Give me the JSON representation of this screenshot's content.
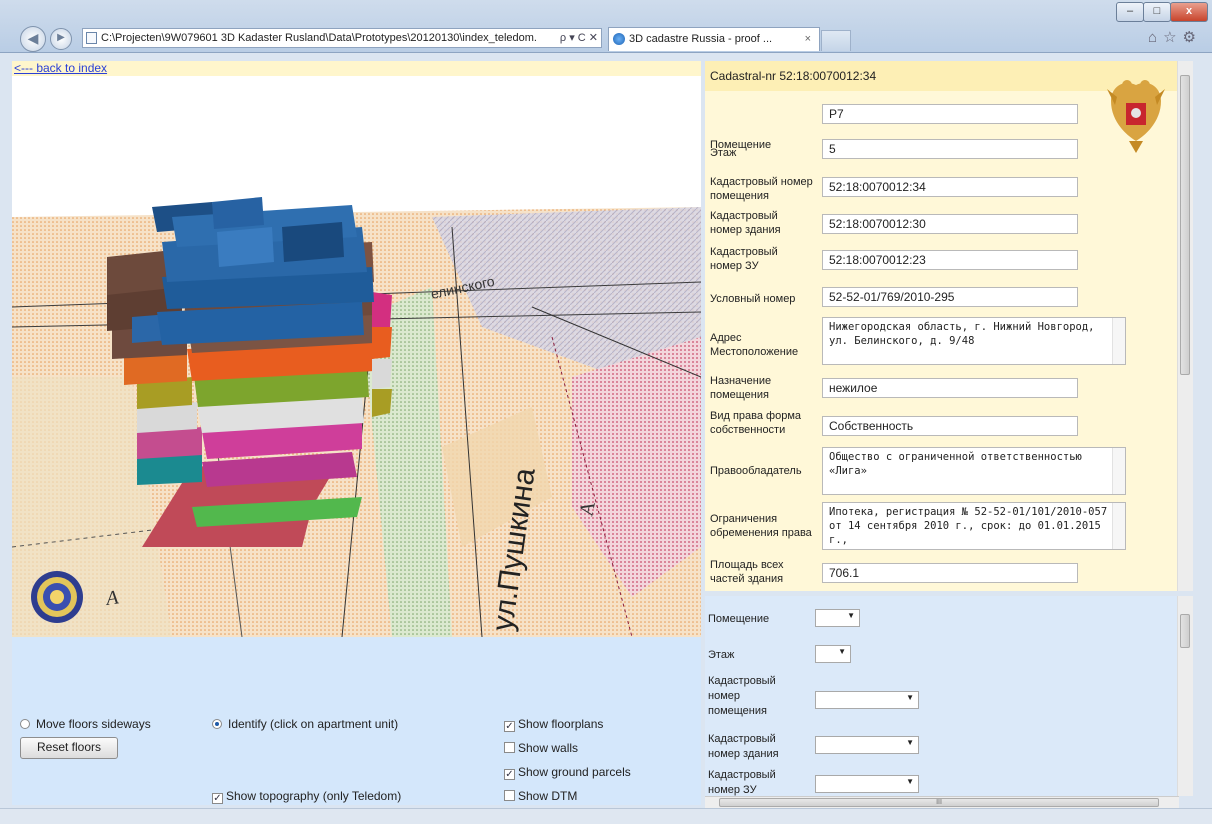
{
  "browser": {
    "address": "C:\\Projecten\\9W079601 3D Kadaster Rusland\\Data\\Prototypes\\20120130\\index_teledom.",
    "address_actions": "ρ ▾ C ✕",
    "tab_title": "3D cadastre Russia - proof ...",
    "tab_close": "×",
    "window_controls": [
      "–",
      "□",
      "x"
    ],
    "toolbar_icons": [
      "home-icon",
      "star-icon",
      "gear-icon"
    ]
  },
  "left": {
    "back_link": "<--- back to index",
    "map": {
      "street_label": "ул.Пушкина",
      "street_label2": "елинского",
      "letter_a": "A",
      "letter_a2": "A"
    },
    "controls": {
      "move_floors": "Move floors sideways",
      "identify": "Identify (click on apartment unit)",
      "reset_floors": "Reset floors",
      "show_floorplans": "Show floorplans",
      "show_walls": "Show walls",
      "show_ground_parcels": "Show ground parcels",
      "show_topography": "Show topography (only Teledom)",
      "show_dtm": "Show DTM",
      "state": {
        "move_floors": false,
        "identify": true,
        "floorplans": true,
        "walls": false,
        "ground_parcels": true,
        "topography": true,
        "dtm": false
      }
    }
  },
  "right": {
    "header": "Cadastral-nr 52:18:0070012:34",
    "fields": [
      {
        "label": "Помещение",
        "value": "P7"
      },
      {
        "label": "Этаж",
        "value": "5"
      },
      {
        "label": "Кадастровый номер помещения",
        "value": "52:18:0070012:34"
      },
      {
        "label": "Кадастровый номер здания",
        "value": "52:18:0070012:30"
      },
      {
        "label": "Кадастровый номер ЗУ",
        "value": "52:18:0070012:23"
      },
      {
        "label": "Условный номер",
        "value": "52-52-01/769/2010-295"
      },
      {
        "label": "Адрес Местоположение",
        "value": "Нижегородская область, г. Нижний Новгород, ул. Белинского, д. 9/48"
      },
      {
        "label": "Назначение помещения",
        "value": "нежилое"
      },
      {
        "label": "Вид права форма собственности",
        "value": "Собственность"
      },
      {
        "label": "Правообладатель",
        "value": "Общество с ограниченной ответственностью «Лига»"
      },
      {
        "label": "Ограничения обременения права",
        "value": "Ипотека, регистрация № 52-52-01/101/2010-057 от 14 сентября 2010 г., срок: до 01.01.2015 г.,"
      },
      {
        "label": "Площадь всех частей здания",
        "value": "706.1"
      }
    ],
    "bottom": {
      "labels": [
        "Помещение",
        "Этаж",
        "Кадастровый номер помещения",
        "Кадастровый номер здания",
        "Кадастровый номер ЗУ"
      ],
      "hscroll_grip": "III"
    }
  },
  "colors": {
    "accent": "#fdefb5",
    "panel": "#d4e7fb",
    "link": "#2a3fd6"
  }
}
